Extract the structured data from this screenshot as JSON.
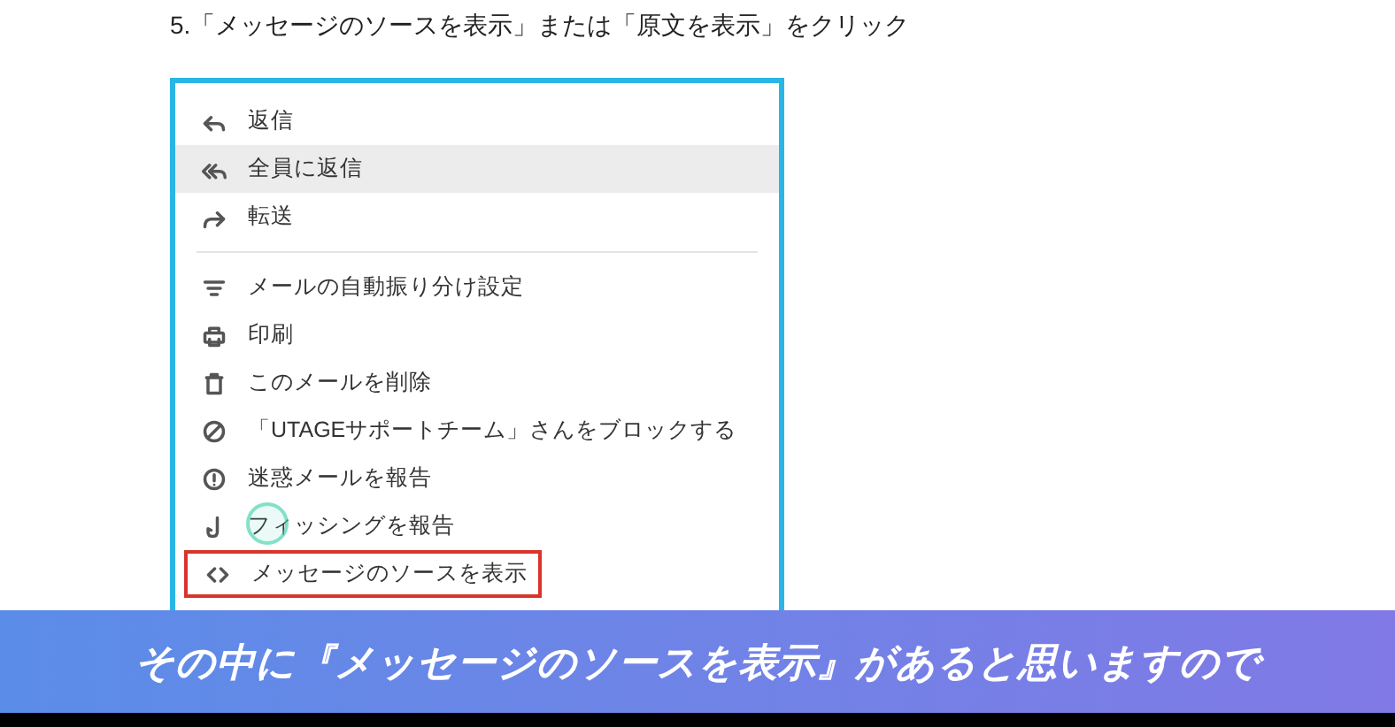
{
  "heading": "5.「メッセージのソースを表示」または「原文を表示」をクリック",
  "menu": {
    "groups": [
      [
        {
          "kind": "reply",
          "label": "返信",
          "hovered": false,
          "outlined": false
        },
        {
          "kind": "reply_all",
          "label": "全員に返信",
          "hovered": true,
          "outlined": false
        },
        {
          "kind": "forward",
          "label": "転送",
          "hovered": false,
          "outlined": false
        }
      ],
      [
        {
          "kind": "filter",
          "label": "メールの自動振り分け設定",
          "hovered": false,
          "outlined": false
        },
        {
          "kind": "print",
          "label": "印刷",
          "hovered": false,
          "outlined": false
        },
        {
          "kind": "delete",
          "label": "このメールを削除",
          "hovered": false,
          "outlined": false
        },
        {
          "kind": "block",
          "label": "「UTAGEサポートチーム」さんをブロックする",
          "hovered": false,
          "outlined": false
        },
        {
          "kind": "report",
          "label": "迷惑メールを報告",
          "hovered": false,
          "outlined": false
        },
        {
          "kind": "phishing",
          "label": "フィッシングを報告",
          "hovered": false,
          "outlined": false
        },
        {
          "kind": "code",
          "label": "メッセージのソースを表示",
          "hovered": false,
          "outlined": true
        }
      ]
    ]
  },
  "subtitle": "その中に『メッセージのソースを表示』があると思いますので"
}
